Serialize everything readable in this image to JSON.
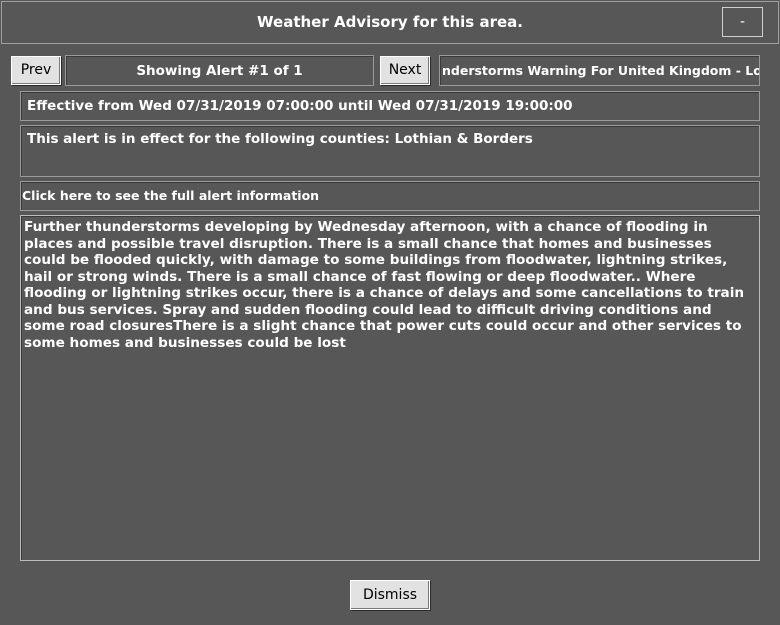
{
  "window": {
    "title": "Weather Advisory for this area.",
    "minimize_label": "-"
  },
  "nav": {
    "prev_label": "Prev",
    "status": "Showing Alert #1 of 1",
    "next_label": "Next",
    "alert_title": "nderstorms Warning For United Kingdom - Lothian"
  },
  "alert": {
    "effective": "Effective from Wed 07/31/2019 07:00:00 until Wed 07/31/2019 19:00:00",
    "counties": "This alert is in effect for the following counties: Lothian & Borders",
    "full_info_link": "Click here to see the full alert information",
    "description": "Further thunderstorms developing by Wednesday afternoon, with a chance of flooding in places and possible travel disruption. There is a small chance that homes and businesses could be flooded quickly, with damage to some buildings from floodwater, lightning strikes, hail or strong winds. There is a small chance of fast flowing or deep floodwater.. Where flooding or lightning strikes occur, there is a chance of delays and some cancellations to train and bus services. Spray and sudden flooding could lead to difficult driving conditions and some road closuresThere is a slight chance that power cuts could occur and other services to some homes and businesses could be lost"
  },
  "footer": {
    "dismiss_label": "Dismiss"
  }
}
